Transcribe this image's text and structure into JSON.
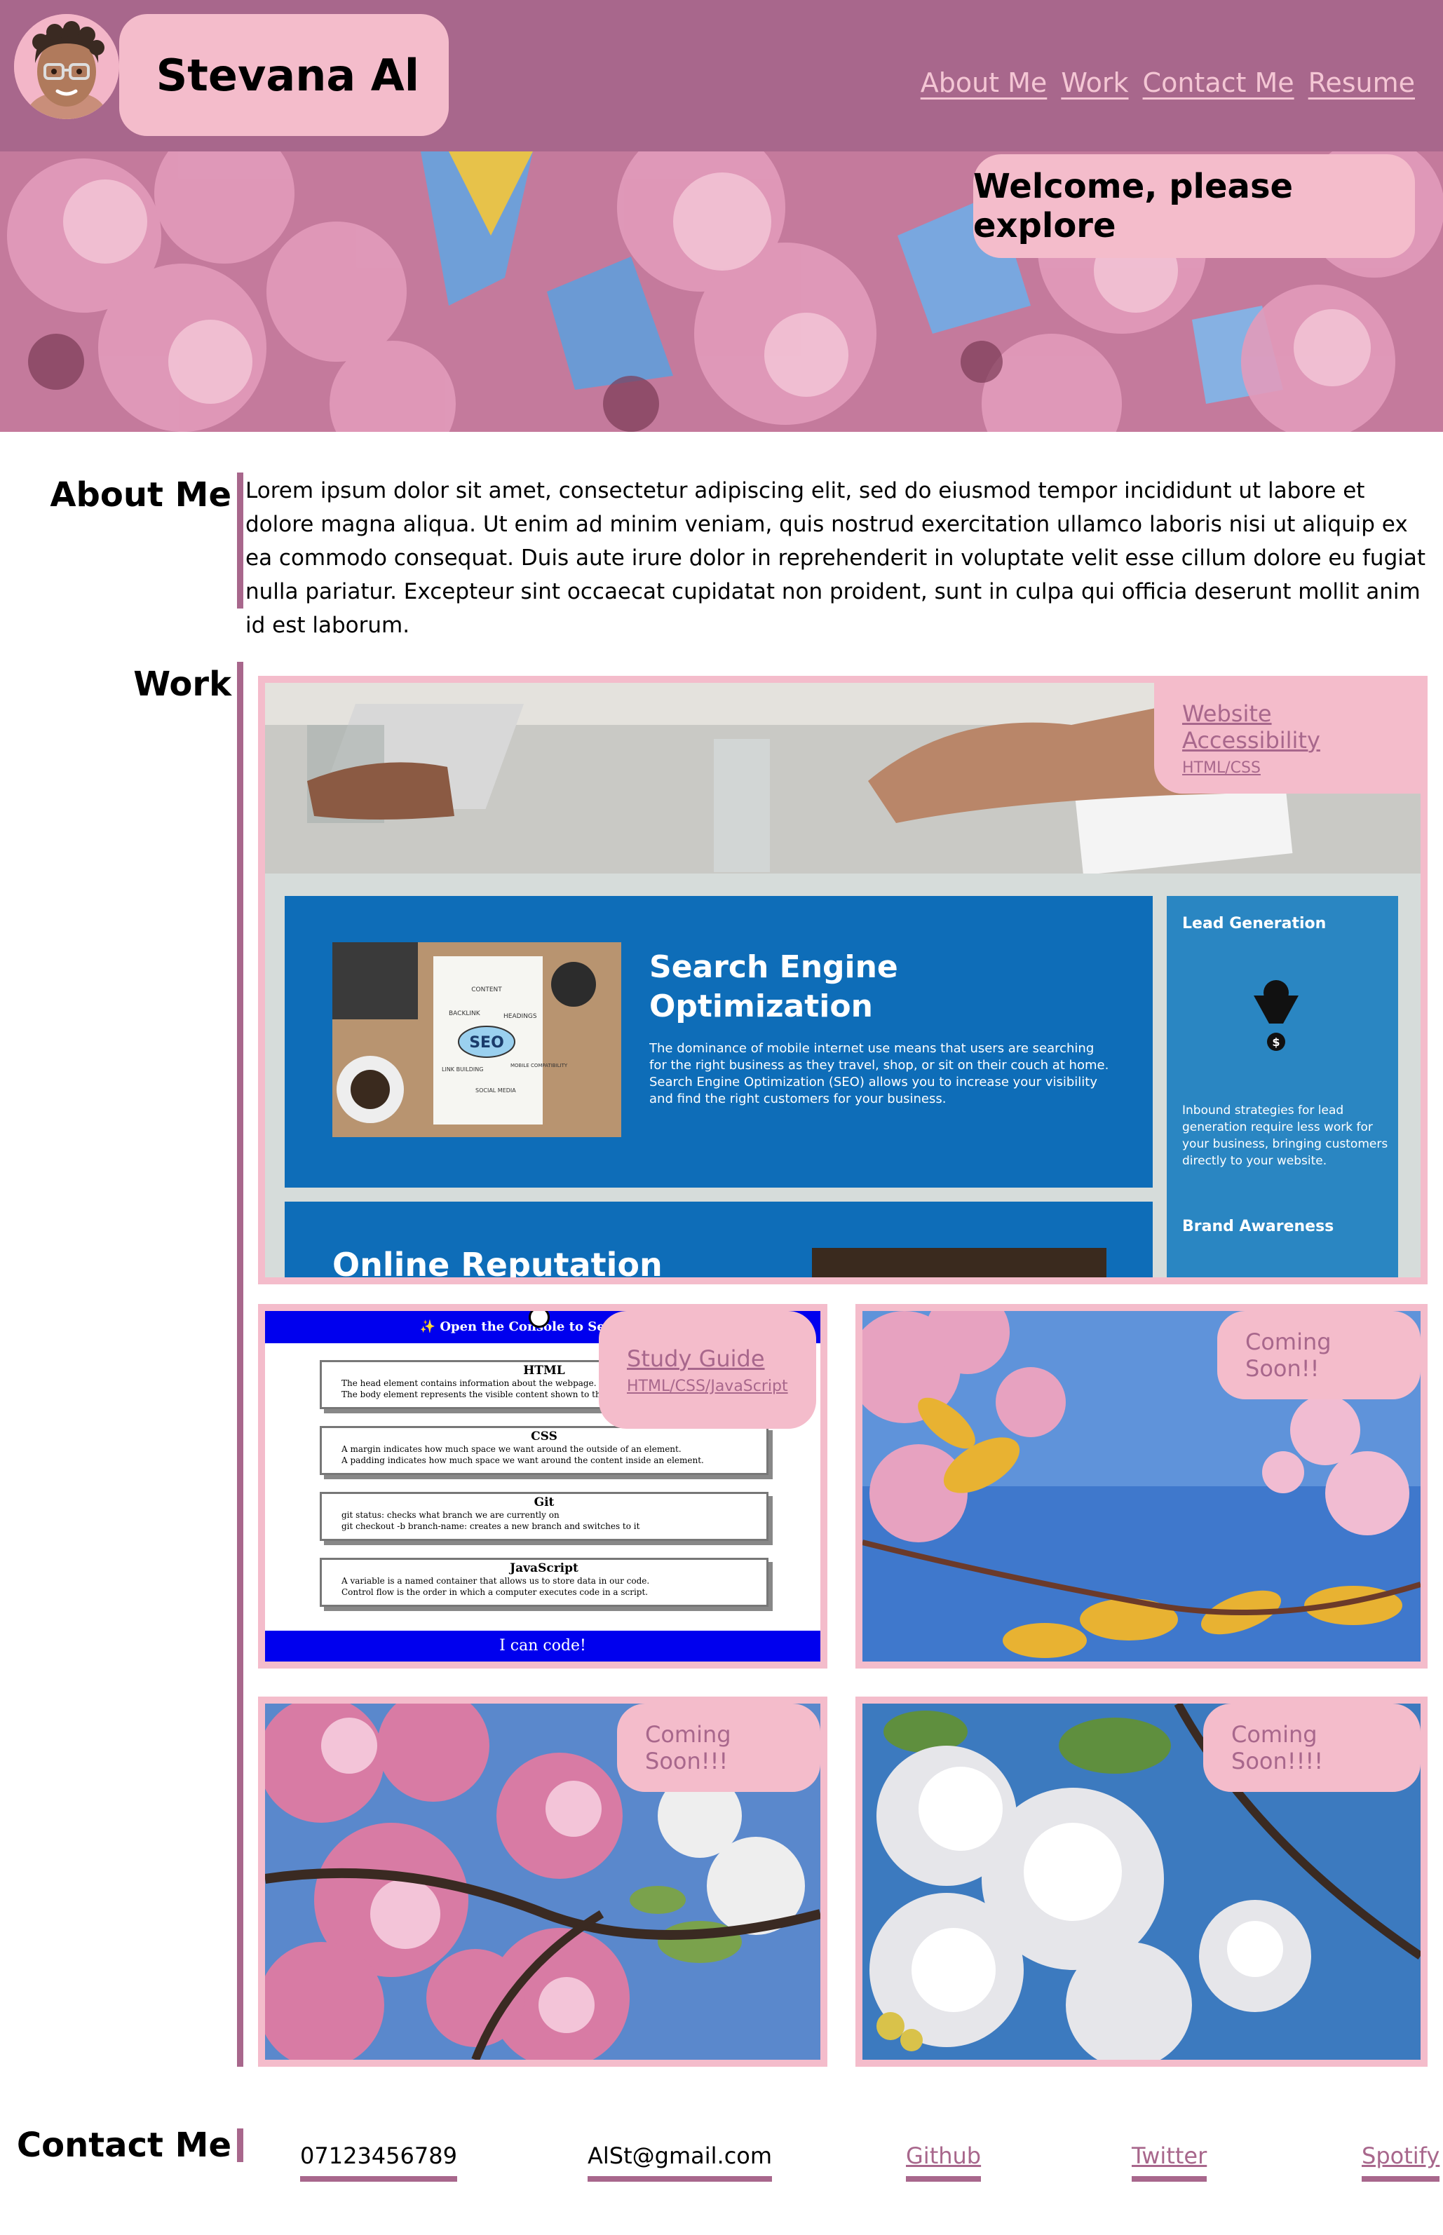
{
  "header": {
    "name": "Stevana Al",
    "nav": [
      "About Me",
      "Work",
      "Contact Me",
      "Resume"
    ]
  },
  "hero": {
    "welcome": "Welcome, please explore"
  },
  "about": {
    "title": "About Me",
    "text": "Lorem ipsum dolor sit amet, consectetur adipiscing elit, sed do eiusmod tempor incididunt ut labore et dolore magna aliqua. Ut enim ad minim veniam, quis nostrud exercitation ullamco laboris nisi ut aliquip ex ea commodo consequat. Duis aute irure dolor in reprehenderit in voluptate velit esse cillum dolore eu fugiat nulla pariatur. Excepteur sint occaecat cupidatat non proident, sunt in culpa qui officia deserunt mollit anim id est laborum."
  },
  "work": {
    "title": "Work",
    "featured": {
      "title": "Website Accessibility",
      "sub": "HTML/CSS",
      "preview": {
        "seo_title": "Search Engine Optimization",
        "seo_text": "The dominance of mobile internet use means that users are searching for the right business as they travel, shop, or sit on their couch at home. Search Engine Optimization (SEO) allows you to increase your visibility and find the right customers for your business.",
        "lead_title": "Lead Generation",
        "lead_text": "Inbound strategies for lead generation require less work for your business, bringing customers directly to your website.",
        "brand_title": "Brand Awareness",
        "reputation_title": "Online Reputation",
        "seo_image_words": [
          "SEO",
          "CONTENT",
          "BACKLINK",
          "HEADINGS",
          "MOBILE COMPATIBILITY",
          "LINK BUILDING",
          "SOCIAL MEDIA"
        ]
      }
    },
    "study": {
      "title": "Study Guide",
      "sub": "HTML/CSS/JavaScript",
      "preview": {
        "banner": "✨ Open the Console to See What's",
        "sections": [
          {
            "h": "HTML",
            "items": [
              "The head element contains information about the webpage.",
              "The body element represents the visible content shown to the"
            ]
          },
          {
            "h": "CSS",
            "items": [
              "A margin indicates how much space we want around the outside of an element.",
              "A padding indicates how much space we want around the content inside an element."
            ]
          },
          {
            "h": "Git",
            "items": [
              "git status: checks what branch we are currently on",
              "git checkout -b branch-name: creates a new branch and switches to it"
            ]
          },
          {
            "h": "JavaScript",
            "items": [
              "A variable is a named container that allows us to store data in our code.",
              "Control flow is the order in which a computer executes code in a script."
            ]
          }
        ],
        "footer": "I can code!"
      }
    },
    "soon1": "Coming Soon!!",
    "soon2": "Coming Soon!!!",
    "soon3": "Coming Soon!!!!"
  },
  "contact": {
    "title": "Contact Me",
    "phone": "07123456789",
    "email": "AlSt@gmail.com",
    "links": [
      "Github",
      "Twitter",
      "Spotify"
    ]
  },
  "colors": {
    "header": "#a8678c",
    "pink": "#f4bccb",
    "nav_link": "#f4c6d4"
  }
}
